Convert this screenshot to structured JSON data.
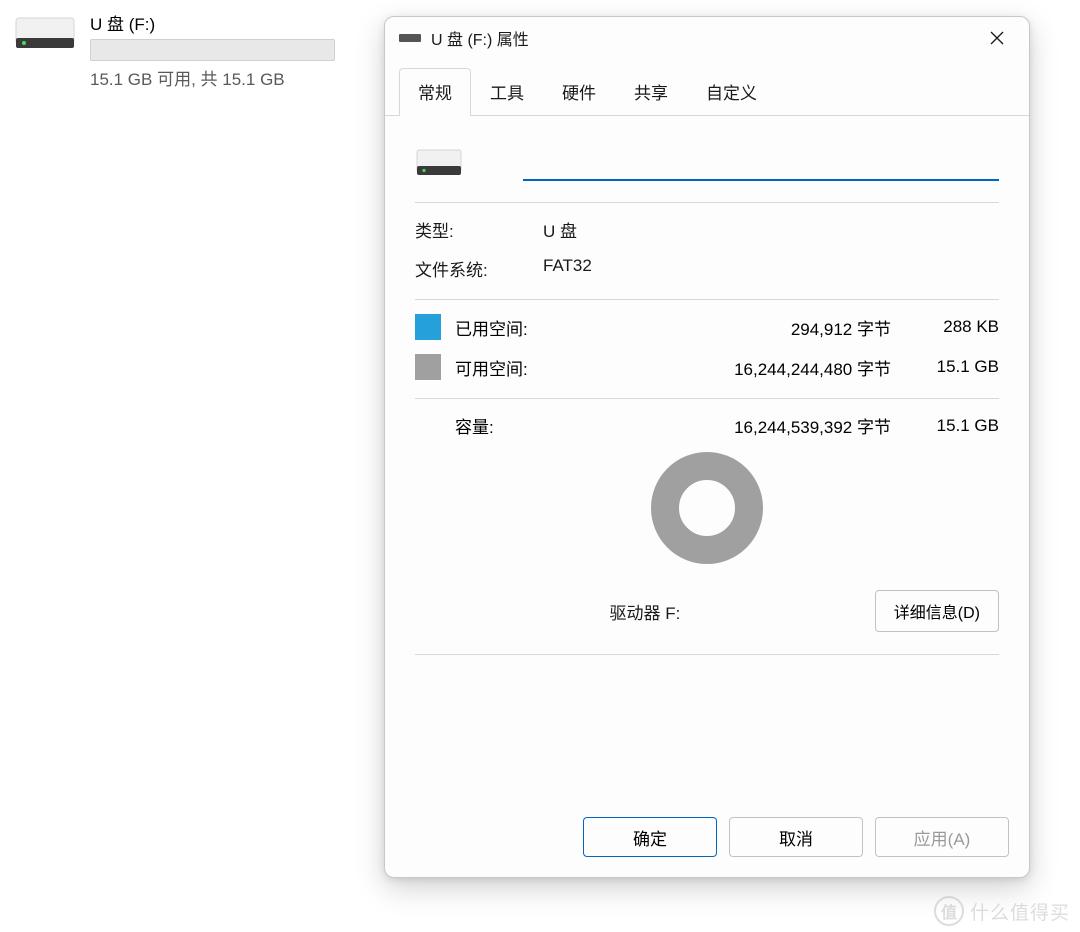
{
  "explorer": {
    "drive_name": "U 盘 (F:)",
    "drive_status": "15.1 GB 可用, 共 15.1 GB"
  },
  "dialog": {
    "title": "U 盘 (F:) 属性",
    "tabs": [
      "常规",
      "工具",
      "硬件",
      "共享",
      "自定义"
    ],
    "active_tab": 0,
    "name_value": "",
    "type_label": "类型:",
    "type_value": "U 盘",
    "fs_label": "文件系统:",
    "fs_value": "FAT32",
    "used_label": "已用空间:",
    "used_bytes": "294,912 字节",
    "used_friendly": "288 KB",
    "free_label": "可用空间:",
    "free_bytes": "16,244,244,480 字节",
    "free_friendly": "15.1 GB",
    "capacity_label": "容量:",
    "capacity_bytes": "16,244,539,392 字节",
    "capacity_friendly": "15.1 GB",
    "drive_caption": "驱动器 F:",
    "details_button": "详细信息(D)",
    "ok_button": "确定",
    "cancel_button": "取消",
    "apply_button": "应用(A)"
  },
  "colors": {
    "accent": "#0067c0",
    "used_swatch": "#26a0da",
    "free_swatch": "#a0a0a0"
  },
  "watermark": {
    "badge": "值",
    "text": "什么值得买"
  },
  "chart_data": {
    "type": "pie",
    "title": "驱动器 F:",
    "series": [
      {
        "name": "已用空间",
        "value": 294912,
        "friendly": "288 KB",
        "color": "#26a0da"
      },
      {
        "name": "可用空间",
        "value": 16244244480,
        "friendly": "15.1 GB",
        "color": "#a0a0a0"
      }
    ],
    "total": {
      "name": "容量",
      "value": 16244539392,
      "friendly": "15.1 GB"
    }
  }
}
